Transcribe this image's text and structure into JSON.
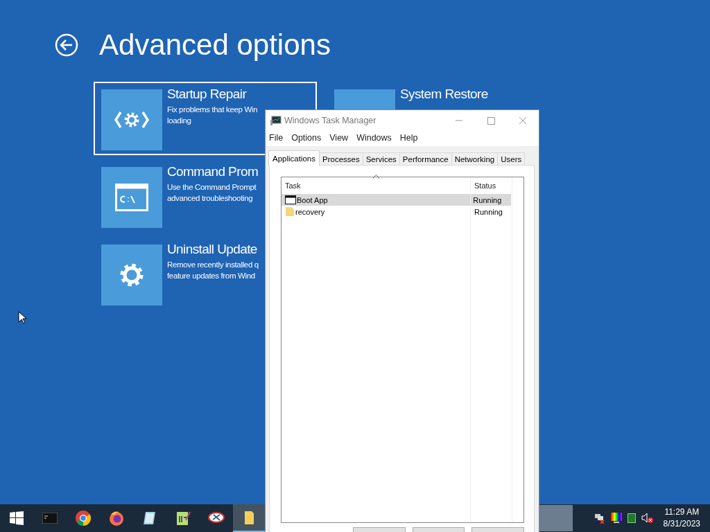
{
  "page": {
    "title": "Advanced options"
  },
  "options": [
    {
      "title": "Startup Repair",
      "lines": [
        "Fix problems that keep Win",
        "loading"
      ],
      "kind": "repair",
      "selected": true
    },
    {
      "title": "Command Prom",
      "lines": [
        "Use the Command Prompt",
        "advanced troubleshooting"
      ],
      "kind": "cmd",
      "selected": false
    },
    {
      "title": "Uninstall Update",
      "lines": [
        "Remove recently installed q",
        "feature updates from Wind"
      ],
      "kind": "gear",
      "selected": false
    },
    {
      "title": "System Restore",
      "kind": "restore",
      "selected": false
    }
  ],
  "task_manager": {
    "title": "Windows Task Manager",
    "menu": [
      "File",
      "Options",
      "View",
      "Windows",
      "Help"
    ],
    "tabs": [
      {
        "label": "Applications",
        "selected": true
      },
      {
        "label": "Processes",
        "selected": false
      },
      {
        "label": "Services",
        "selected": false
      },
      {
        "label": "Performance",
        "selected": false
      },
      {
        "label": "Networking",
        "selected": false
      },
      {
        "label": "Users",
        "selected": false
      }
    ],
    "columns": [
      "Task",
      "Status"
    ],
    "rows": [
      {
        "task": "Boot App",
        "status": "Running",
        "kind": "window",
        "selected": true
      },
      {
        "task": "recovery",
        "status": "Running",
        "kind": "folder",
        "selected": false
      }
    ]
  },
  "taskbar": {
    "apps": [
      {
        "kind": "cmd",
        "active": false
      },
      {
        "kind": "chrome",
        "active": false
      },
      {
        "kind": "firefox",
        "active": false
      },
      {
        "kind": "notes",
        "active": false
      },
      {
        "kind": "editor",
        "active": false
      },
      {
        "kind": "snip",
        "active": false
      },
      {
        "kind": "folder",
        "active": true
      }
    ],
    "time": "11:29 AM",
    "date": "8/31/2023"
  }
}
